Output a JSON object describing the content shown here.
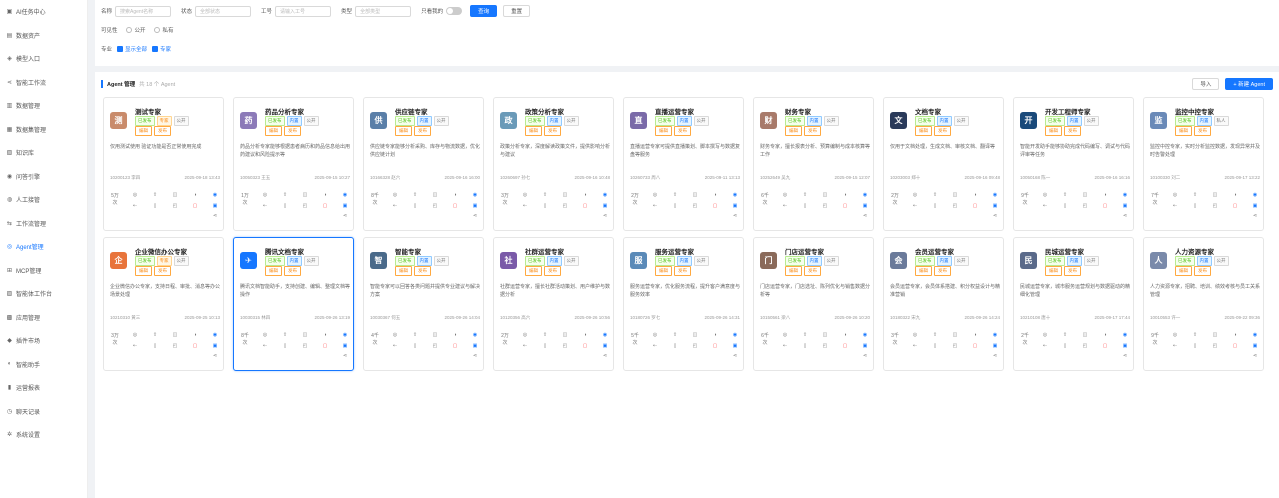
{
  "sidebar": {
    "items": [
      {
        "label": "AI任务中心",
        "icon": "cube-icon"
      },
      {
        "label": "数据资产",
        "icon": "database-icon"
      },
      {
        "label": "模型入口",
        "icon": "model-icon"
      },
      {
        "label": "智能工作流",
        "icon": "share-icon"
      },
      {
        "label": "数据管理",
        "icon": "folder-icon"
      },
      {
        "label": "数据集管理",
        "icon": "dataset-icon"
      },
      {
        "label": "知识库",
        "icon": "book-icon"
      },
      {
        "label": "问答引擎",
        "icon": "chat-icon"
      },
      {
        "label": "人工接管",
        "icon": "user-icon"
      },
      {
        "label": "工作流管理",
        "icon": "flow-icon"
      },
      {
        "label": "Agent管理",
        "icon": "robot-icon",
        "active": true
      },
      {
        "label": "MCP管理",
        "icon": "plug-icon"
      },
      {
        "label": "智能体工作台",
        "icon": "desk-icon"
      },
      {
        "label": "应用管理",
        "icon": "app-icon"
      },
      {
        "label": "插件市场",
        "icon": "puzzle-icon"
      },
      {
        "label": "智能助手",
        "icon": "assistant-icon"
      },
      {
        "label": "运营报表",
        "icon": "chart-icon"
      },
      {
        "label": "聊天记录",
        "icon": "history-icon"
      },
      {
        "label": "系统设置",
        "icon": "gear-icon"
      }
    ]
  },
  "filter": {
    "name_label": "名称",
    "name_placeholder": "搜索Agent名称",
    "status_label": "状态",
    "status_placeholder": "全部状态",
    "job_label": "工号",
    "job_placeholder": "请输入工号",
    "type_label": "类型",
    "type_placeholder": "全部类型",
    "only_mine_label": "只看我的",
    "query_button": "查询",
    "reset_button": "重置",
    "visibility_label": "可见性",
    "visibility_options": [
      "公开",
      "私有"
    ],
    "category_label": "专业",
    "category_options": [
      "显示全部",
      "专家"
    ]
  },
  "main": {
    "title": "Agent 管理",
    "count_text": "共 18 个 Agent",
    "import_button": "导入",
    "create_button": "+ 新建 Agent"
  },
  "card_labels": {
    "edit": "编辑",
    "publish": "发布"
  },
  "cards": [
    {
      "name": "测试专家",
      "avatar_color": "#c98b6b",
      "avatar_char": "测",
      "tags": [
        [
          "已发布",
          "green"
        ],
        [
          "专家",
          "orange"
        ],
        [
          "公开",
          "gray"
        ]
      ],
      "desc": "仅用测试使用 验证功能是否正常使用完成",
      "owner": "10200123 李四",
      "time": "2025-09-18 13:43",
      "stat": "5万次"
    },
    {
      "name": "药品分析专家",
      "avatar_color": "#8c7ab8",
      "avatar_char": "药",
      "tags": [
        [
          "已发布",
          "green"
        ],
        [
          "内置",
          "blue"
        ],
        [
          "公开",
          "gray"
        ]
      ],
      "desc": "药品分析专家能够根据患者病历和药品信息给出用药建议和风险提示等",
      "owner": "10050323 王五",
      "time": "2025-09-15 10:27",
      "stat": "1万次"
    },
    {
      "name": "供应链专家",
      "avatar_color": "#5a7fa8",
      "avatar_char": "供",
      "tags": [
        [
          "已发布",
          "green"
        ],
        [
          "内置",
          "blue"
        ],
        [
          "公开",
          "gray"
        ]
      ],
      "desc": "供应链专家能够分析采购、库存与物流数据，优化供应链计划",
      "owner": "10166328 赵六",
      "time": "2025-09-16 16:00",
      "stat": "8千次"
    },
    {
      "name": "政策分析专家",
      "avatar_color": "#6a9ab8",
      "avatar_char": "政",
      "tags": [
        [
          "已发布",
          "green"
        ],
        [
          "内置",
          "blue"
        ],
        [
          "公开",
          "gray"
        ]
      ],
      "desc": "政策分析专家，深度解读政策文件，提供影响分析与建议",
      "owner": "10260697 孙七",
      "time": "2025-09-16 10:48",
      "stat": "3万次"
    },
    {
      "name": "直播运营专家",
      "avatar_color": "#7a6aa8",
      "avatar_char": "直",
      "tags": [
        [
          "已发布",
          "green"
        ],
        [
          "内置",
          "blue"
        ],
        [
          "公开",
          "gray"
        ]
      ],
      "desc": "直播运营专家可提供直播策划、脚本撰写与数据复盘等服务",
      "owner": "10260733 周八",
      "time": "2025-09-11 13:13",
      "stat": "2万次"
    },
    {
      "name": "财务专家",
      "avatar_color": "#a87a6a",
      "avatar_char": "财",
      "tags": [
        [
          "已发布",
          "green"
        ],
        [
          "内置",
          "blue"
        ],
        [
          "公开",
          "gray"
        ]
      ],
      "desc": "财务专家，擅长报表分析、预算编制与成本核算等工作",
      "owner": "10252649 吴九",
      "time": "2025-09-15 12:07",
      "stat": "6千次"
    },
    {
      "name": "文档专家",
      "avatar_color": "#2a3a5a",
      "avatar_char": "文",
      "tags": [
        [
          "已发布",
          "green"
        ],
        [
          "内置",
          "blue"
        ],
        [
          "公开",
          "gray"
        ]
      ],
      "desc": "仅用于文档处理，生成文档、审核文档、翻译等",
      "owner": "10203003 郑十",
      "time": "2025-09-16 09:48",
      "stat": "2万次"
    },
    {
      "name": "开发工程师专家",
      "avatar_color": "#1a4a7a",
      "avatar_char": "开",
      "tags": [
        [
          "已发布",
          "green"
        ],
        [
          "内置",
          "blue"
        ],
        [
          "公开",
          "gray"
        ]
      ],
      "desc": "智能开发助手能够协助完成代码编写、调试与代码评审等任务",
      "owner": "10050168 陈一",
      "time": "2025-09-16 16:16",
      "stat": "9千次"
    },
    {
      "name": "监控中控专家",
      "avatar_color": "#6a8ab8",
      "avatar_char": "监",
      "tags": [
        [
          "已发布",
          "green"
        ],
        [
          "内置",
          "blue"
        ],
        [
          "私人",
          "gray"
        ]
      ],
      "desc": "监控中控专家，实时分析监控数据，发现异常并及时告警处理",
      "owner": "10100330 刘二",
      "time": "2025-09-17 13:22",
      "stat": "7千次"
    },
    {
      "name": "企业微信办公专家",
      "avatar_color": "#e8743b",
      "avatar_char": "企",
      "tags": [
        [
          "已发布",
          "green"
        ],
        [
          "专家",
          "orange"
        ],
        [
          "公开",
          "gray"
        ]
      ],
      "desc": "企业微信办公专家，支持日程、审批、消息等办公场景处理",
      "owner": "10210310 黄三",
      "time": "2025-09-25 10:13",
      "stat": "3万次"
    },
    {
      "name": "腾讯文档专家",
      "avatar_color": "#1677ff",
      "avatar_char": "✈",
      "tags": [
        [
          "已发布",
          "green"
        ],
        [
          "内置",
          "blue"
        ],
        [
          "公开",
          "gray"
        ]
      ],
      "desc": "腾讯文档智能助手，支持创建、编辑、整理文档等操作",
      "owner": "10030315 林四",
      "time": "2025-09-26 13:19",
      "stat": "8千次"
    },
    {
      "name": "智能专家",
      "avatar_color": "#4a6a8a",
      "avatar_char": "智",
      "tags": [
        [
          "已发布",
          "green"
        ],
        [
          "内置",
          "blue"
        ],
        [
          "公开",
          "gray"
        ]
      ],
      "desc": "智能专家可以回答各类问题并提供专业建议与解决方案",
      "owner": "10030367 何五",
      "time": "2025-09-26 14:04",
      "stat": "4千次"
    },
    {
      "name": "社群运营专家",
      "avatar_color": "#7a5aa8",
      "avatar_char": "社",
      "tags": [
        [
          "已发布",
          "green"
        ],
        [
          "内置",
          "blue"
        ],
        [
          "公开",
          "gray"
        ]
      ],
      "desc": "社群运营专家，擅长社群活动策划、用户维护与数据分析",
      "owner": "10120356 高六",
      "time": "2025-09-26 10:56",
      "stat": "2万次"
    },
    {
      "name": "服务运营专家",
      "avatar_color": "#5a8ab8",
      "avatar_char": "服",
      "tags": [
        [
          "已发布",
          "green"
        ],
        [
          "内置",
          "blue"
        ],
        [
          "公开",
          "gray"
        ]
      ],
      "desc": "服务运营专家，优化服务流程，提升客户满意度与服务效率",
      "owner": "10180726 罗七",
      "time": "2025-09-26 14:31",
      "stat": "5千次"
    },
    {
      "name": "门店运营专家",
      "avatar_color": "#8a6a5a",
      "avatar_char": "门",
      "tags": [
        [
          "已发布",
          "green"
        ],
        [
          "内置",
          "blue"
        ],
        [
          "公开",
          "gray"
        ]
      ],
      "desc": "门店运营专家，门店选址、陈列优化与销售数据分析等",
      "owner": "10150561 梁八",
      "time": "2025-09-26 10:20",
      "stat": "6千次"
    },
    {
      "name": "会员运营专家",
      "avatar_color": "#6a7a9a",
      "avatar_char": "会",
      "tags": [
        [
          "已发布",
          "green"
        ],
        [
          "内置",
          "blue"
        ],
        [
          "公开",
          "gray"
        ]
      ],
      "desc": "会员运营专家，会员体系搭建、积分权益设计与精准营销",
      "owner": "10180322 宋九",
      "time": "2025-09-26 14:24",
      "stat": "3千次"
    },
    {
      "name": "民城运营专家",
      "avatar_color": "#5a6a8a",
      "avatar_char": "民",
      "tags": [
        [
          "已发布",
          "green"
        ],
        [
          "内置",
          "blue"
        ],
        [
          "公开",
          "gray"
        ]
      ],
      "desc": "民城运营专家，城市服务运营规划与数据驱动的精细化管理",
      "owner": "10210108 唐十",
      "time": "2025-09-17 17:44",
      "stat": "2千次"
    },
    {
      "name": "人力资源专家",
      "avatar_color": "#7a8aaa",
      "avatar_char": "人",
      "tags": [
        [
          "已发布",
          "green"
        ],
        [
          "内置",
          "blue"
        ],
        [
          "公开",
          "gray"
        ]
      ],
      "desc": "人力资源专家，招聘、培训、绩效考核与员工关系管理",
      "owner": "10010553 许一",
      "time": "2025-09-22 09:36",
      "stat": "9千次"
    }
  ]
}
